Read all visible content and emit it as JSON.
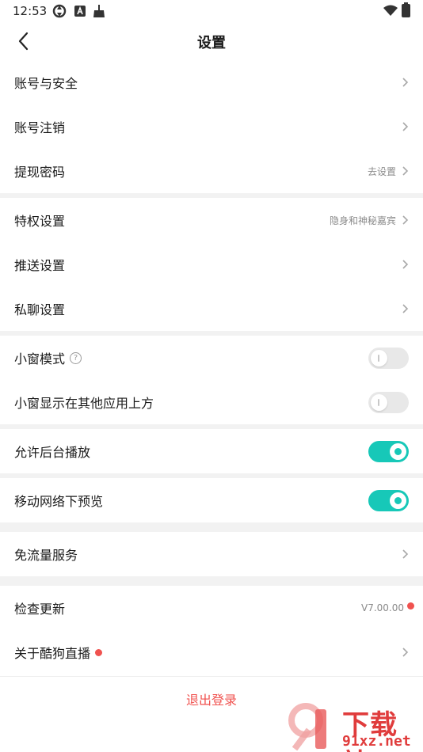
{
  "status_bar": {
    "time": "12:53"
  },
  "header": {
    "title": "设置"
  },
  "sections": {
    "account": [
      {
        "label": "账号与安全",
        "value": ""
      },
      {
        "label": "账号注销",
        "value": ""
      },
      {
        "label": "提现密码",
        "value": "去设置"
      }
    ],
    "privacy": [
      {
        "label": "特权设置",
        "value": "隐身和神秘嘉宾"
      },
      {
        "label": "推送设置",
        "value": ""
      },
      {
        "label": "私聊设置",
        "value": ""
      }
    ],
    "window": [
      {
        "label": "小窗模式",
        "toggle": false,
        "help": "?"
      },
      {
        "label": "小窗显示在其他应用上方",
        "toggle": false
      }
    ],
    "background_play": {
      "label": "允许后台播放",
      "toggle": true
    },
    "mobile_preview": {
      "label": "移动网络下预览",
      "toggle": true
    },
    "free_data": {
      "label": "免流量服务"
    },
    "about": {
      "check_update": {
        "label": "检查更新",
        "value": "V7.00.00"
      },
      "about_app": {
        "label": "关于酷狗直播"
      }
    }
  },
  "logout": {
    "label": "退出登录"
  },
  "watermark": {
    "brand": "下载站",
    "domain": "91xz.net"
  },
  "colors": {
    "accent": "#17c8b8",
    "danger": "#f0524f"
  }
}
